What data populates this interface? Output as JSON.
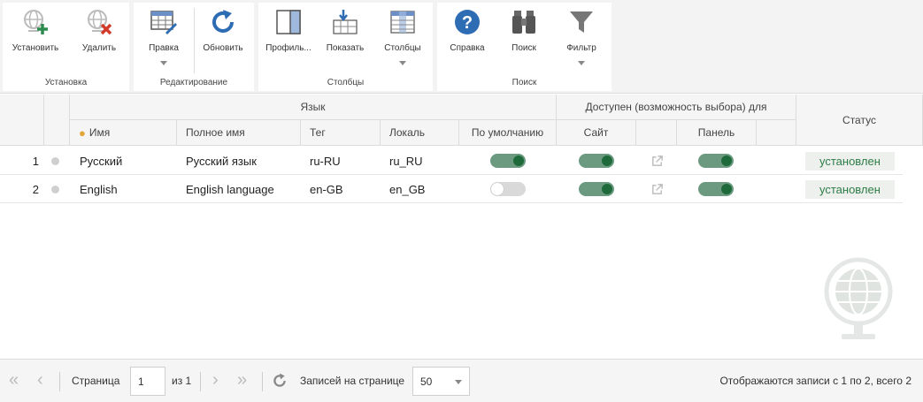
{
  "toolbar": {
    "groups": [
      {
        "label": "Установка",
        "buttons": [
          {
            "label": "Установить"
          },
          {
            "label": "Удалить"
          }
        ]
      },
      {
        "label": "Редактирование",
        "buttons": [
          {
            "label": "Правка"
          },
          {
            "label": "Обновить"
          }
        ]
      },
      {
        "label": "Столбцы",
        "buttons": [
          {
            "label": "Профиль..."
          },
          {
            "label": "Показать"
          },
          {
            "label": "Столбцы"
          }
        ]
      },
      {
        "label": "Поиск",
        "buttons": [
          {
            "label": "Справка"
          },
          {
            "label": "Поиск"
          },
          {
            "label": "Фильтр"
          }
        ]
      }
    ]
  },
  "grid": {
    "group_headers": {
      "language": "Язык",
      "available": "Доступен (возможность выбора) для",
      "status": "Статус"
    },
    "columns": {
      "name": "Имя",
      "full_name": "Полное имя",
      "tag": "Тег",
      "locale": "Локаль",
      "default": "По умолчанию",
      "site": "Сайт",
      "panel": "Панель"
    },
    "rows": [
      {
        "num": "1",
        "name": "Русский",
        "full_name": "Русский язык",
        "tag": "ru-RU",
        "locale": "ru_RU",
        "default": true,
        "site": true,
        "panel": true,
        "status": "установлен"
      },
      {
        "num": "2",
        "name": "English",
        "full_name": "English language",
        "tag": "en-GB",
        "locale": "en_GB",
        "default": false,
        "site": true,
        "panel": true,
        "status": "установлен"
      }
    ]
  },
  "pager": {
    "page_label": "Страница",
    "page_value": "1",
    "of_label": "из 1",
    "per_page_label": "Записей на странице",
    "per_page_value": "50",
    "summary": "Отображаются записи с 1 по 2, всего 2"
  },
  "colors": {
    "accent": "#1f6a3a",
    "toggle_on_track": "#6b9a80",
    "status_text": "#2e7d46",
    "help_blue": "#2e6db4"
  }
}
